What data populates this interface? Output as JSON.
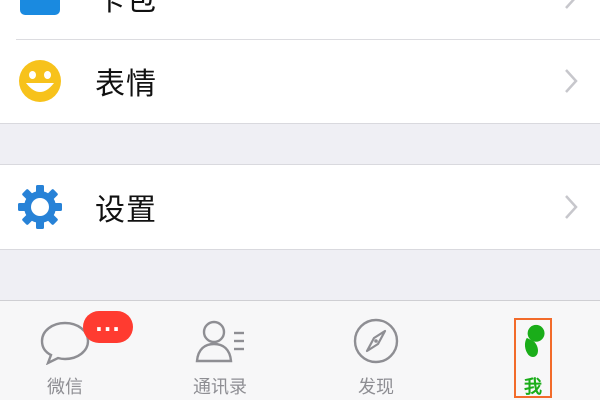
{
  "settings_list": {
    "items": [
      {
        "label": "卡包",
        "icon": "card-wallet-icon"
      },
      {
        "label": "表情",
        "icon": "smiley-icon"
      },
      {
        "label": "设置",
        "icon": "gear-icon"
      }
    ]
  },
  "tabbar": {
    "tabs": [
      {
        "label": "微信",
        "icon": "chat-bubble-icon",
        "badge": "..."
      },
      {
        "label": "通讯录",
        "icon": "contacts-icon"
      },
      {
        "label": "发现",
        "icon": "compass-icon"
      },
      {
        "label": "我",
        "icon": "me-icon",
        "active": true
      }
    ]
  },
  "colors": {
    "accent": "#1aad19",
    "badge": "#ff3b30",
    "gear": "#2782d7",
    "smiley": "#f7c21b",
    "card": "#1a8ae0",
    "highlight_box": "#f26b2a"
  }
}
